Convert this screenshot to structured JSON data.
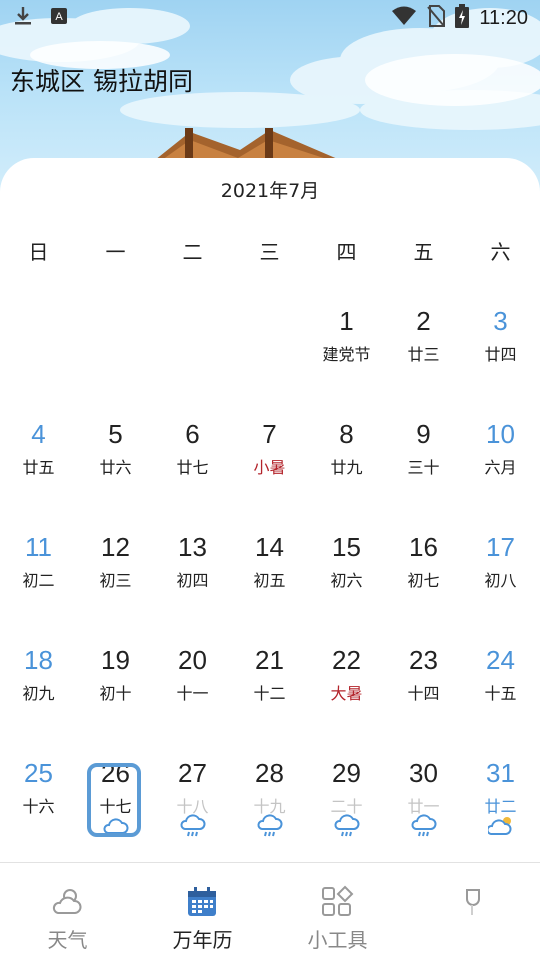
{
  "status_bar": {
    "time": "11:20"
  },
  "location": "东城区 锡拉胡同",
  "calendar": {
    "month_title": "2021年7月",
    "weekdays": [
      "日",
      "一",
      "二",
      "三",
      "四",
      "五",
      "六"
    ],
    "days": [
      {
        "n": "1",
        "lunar": "建党节"
      },
      {
        "n": "2",
        "lunar": "廿三"
      },
      {
        "n": "3",
        "lunar": "廿四"
      },
      {
        "n": "4",
        "lunar": "廿五"
      },
      {
        "n": "5",
        "lunar": "廿六"
      },
      {
        "n": "6",
        "lunar": "廿七"
      },
      {
        "n": "7",
        "lunar": "小暑"
      },
      {
        "n": "8",
        "lunar": "廿九"
      },
      {
        "n": "9",
        "lunar": "三十"
      },
      {
        "n": "10",
        "lunar": "六月"
      },
      {
        "n": "11",
        "lunar": "初二"
      },
      {
        "n": "12",
        "lunar": "初三"
      },
      {
        "n": "13",
        "lunar": "初四"
      },
      {
        "n": "14",
        "lunar": "初五"
      },
      {
        "n": "15",
        "lunar": "初六"
      },
      {
        "n": "16",
        "lunar": "初七"
      },
      {
        "n": "17",
        "lunar": "初八"
      },
      {
        "n": "18",
        "lunar": "初九"
      },
      {
        "n": "19",
        "lunar": "初十"
      },
      {
        "n": "20",
        "lunar": "十一"
      },
      {
        "n": "21",
        "lunar": "十二"
      },
      {
        "n": "22",
        "lunar": "大暑"
      },
      {
        "n": "23",
        "lunar": "十四"
      },
      {
        "n": "24",
        "lunar": "十五"
      },
      {
        "n": "25",
        "lunar": "十六"
      },
      {
        "n": "26",
        "lunar": "十七"
      },
      {
        "n": "27",
        "lunar": "十八"
      },
      {
        "n": "28",
        "lunar": "十九"
      },
      {
        "n": "29",
        "lunar": "二十"
      },
      {
        "n": "30",
        "lunar": "廿一"
      },
      {
        "n": "31",
        "lunar": "廿二"
      }
    ],
    "weather_icons": {
      "26": "cloudy-icon",
      "27": "rain-icon",
      "28": "rain-icon",
      "29": "rain-icon",
      "30": "rain-icon",
      "31": "partly-cloudy-icon"
    }
  },
  "nav": {
    "items": [
      {
        "label": "天气",
        "icon": "weather-icon"
      },
      {
        "label": "万年历",
        "icon": "calendar-icon"
      },
      {
        "label": "小工具",
        "icon": "tools-icon"
      },
      {
        "label": "",
        "icon": "leaf-icon"
      }
    ]
  },
  "colors": {
    "accent": "#4a93d9",
    "festival_red": "#b3242b",
    "today_border": "#5b9bd5"
  }
}
